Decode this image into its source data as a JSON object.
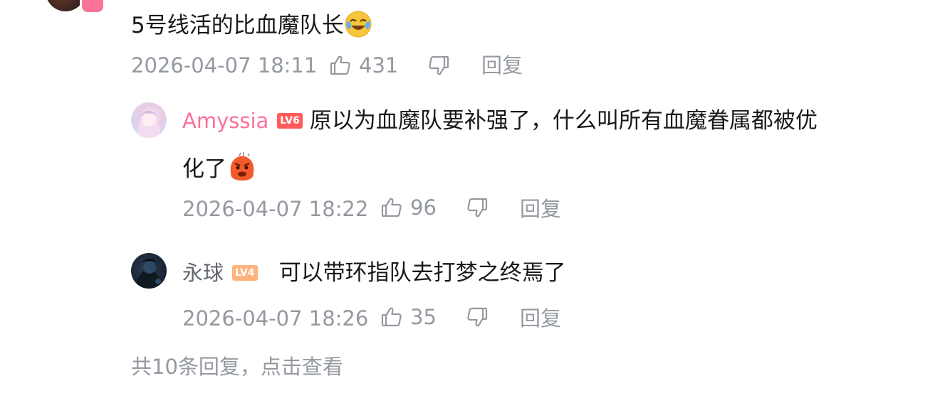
{
  "root_comment": {
    "text": "5号线活的比血魔队长",
    "emoji": "crying-laughing-emoji",
    "timestamp": "2026-04-07 18:11",
    "like_count": "431",
    "reply_label": "回复"
  },
  "replies": [
    {
      "username": "Amyssia",
      "username_color": "#fb7299",
      "level": "LV6",
      "text_line1": "原以为血魔队要补强了，什么叫所有血魔眷属都被优",
      "text_line2": "化了",
      "emoji": "angry-blob-emoji",
      "timestamp": "2026-04-07 18:22",
      "like_count": "96",
      "reply_label": "回复"
    },
    {
      "username": "永球",
      "username_color": "#61666d",
      "level": "LV4",
      "text": "可以带环指队去打梦之终焉了",
      "timestamp": "2026-04-07 18:26",
      "like_count": "35",
      "reply_label": "回复"
    }
  ],
  "more_replies_text": "共10条回复，点击查看",
  "icons": {
    "like": "thumbs-up-icon",
    "dislike": "thumbs-down-icon"
  },
  "colors": {
    "meta_gray": "#9499a0",
    "text": "#18191c",
    "accent_pink": "#fb7299"
  }
}
